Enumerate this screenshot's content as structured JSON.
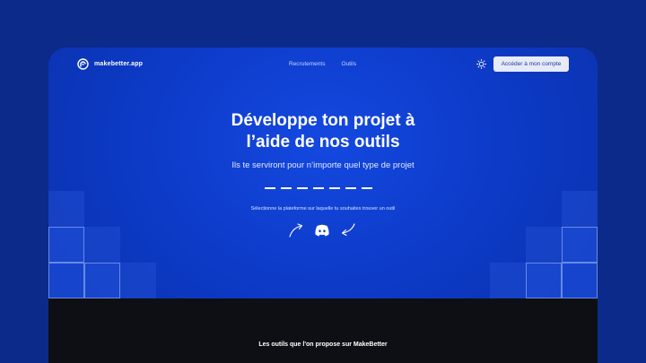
{
  "brand": {
    "name": "makebetter.app"
  },
  "nav": {
    "links": [
      "Recrutements",
      "Outils"
    ]
  },
  "header": {
    "theme_icon": "sun-icon",
    "account_button": "Accéder à mon compte"
  },
  "hero": {
    "title_line1": "Développe ton projet à",
    "title_line2": "l’aide de nos outils",
    "subtitle": "Ils te serviront pour n’importe quel type de projet",
    "platform_label": "Sélectionne la plateforme sur laquelle tu souhaites trouver un outil",
    "platform_icon": "discord-icon"
  },
  "tools_section": {
    "title": "Les outils que l'on propose sur MakeBetter"
  },
  "colors": {
    "page_bg": "#0b2a8a",
    "hero_bg": "#0d3bc8",
    "button_bg": "#e6ebf7",
    "footer_bg": "#0d0f14"
  }
}
